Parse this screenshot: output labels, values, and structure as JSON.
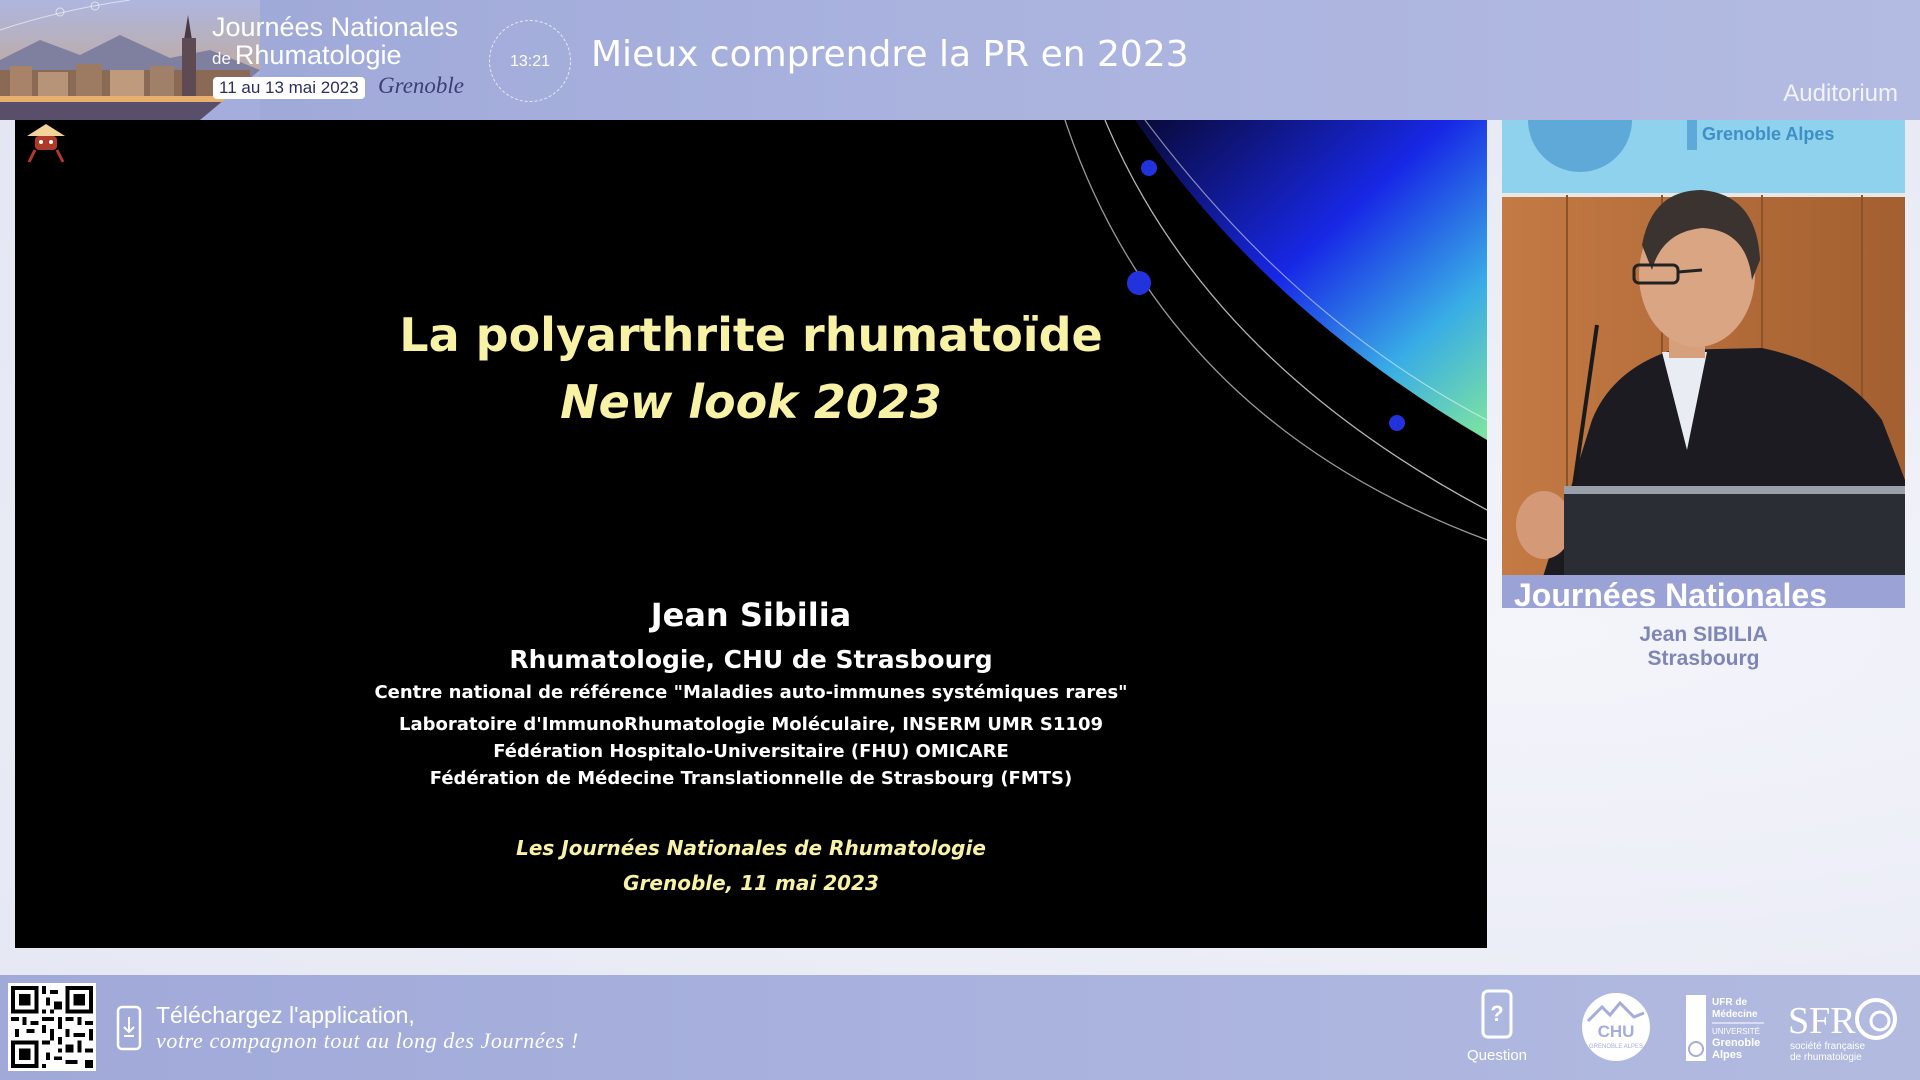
{
  "header": {
    "event_line1": "Journées Nationales",
    "event_de": "de",
    "event_line2": "Rhumatologie",
    "event_dates": "11 au 13 mai 2023",
    "event_city": "Grenoble",
    "clock_time": "13:21",
    "session_title": "Mieux comprendre la PR en 2023",
    "room": "Auditorium"
  },
  "slide": {
    "title": "La polyarthrite rhumatoïde",
    "subtitle": "New look 2023",
    "author": "Jean Sibilia",
    "affiliations": [
      "Rhumatologie, CHU de Strasbourg",
      "Centre national de référence \"Maladies auto-immunes systémiques rares\"",
      "Laboratoire d'ImmunoRhumatologie Moléculaire, INSERM UMR S1109",
      "Fédération Hospitalo-Universitaire (FHU) OMICARE",
      "Fédération de Médecine Translationnelle de Strasbourg (FMTS)"
    ],
    "event": "Les Journées Nationales de Rhumatologie",
    "place_date": "Grenoble, 11 mai 2023"
  },
  "speaker": {
    "name": "Jean SIBILIA",
    "city": "Strasbourg",
    "backdrop_text": "Journées Nationales",
    "banner_text": "Grenoble Alpes"
  },
  "footer": {
    "app_line1": "Téléchargez l'application,",
    "app_line2": "votre compagnon tout au long des Journées !",
    "question_label": "Question",
    "logos": {
      "chu": "CHU",
      "chu_sub": "GRENOBLE ALPES",
      "ufr_line1": "UFR de",
      "ufr_line2": "Médecine",
      "ufr_line3": "UNIVERSITÉ",
      "ufr_line4": "Grenoble",
      "ufr_line5": "Alpes",
      "sfr": "SFR",
      "sfr_sub1": "société française",
      "sfr_sub2": "de rhumatologie"
    }
  },
  "colors": {
    "header_bg": "#a9b2de",
    "slide_title": "#f7f2a6",
    "speaker_name": "#7f86b6",
    "footer_bg": "#abb4df"
  },
  "icons": {
    "phone": "download-phone-icon",
    "question": "question-phone-icon",
    "qr": "qr-code-icon"
  }
}
